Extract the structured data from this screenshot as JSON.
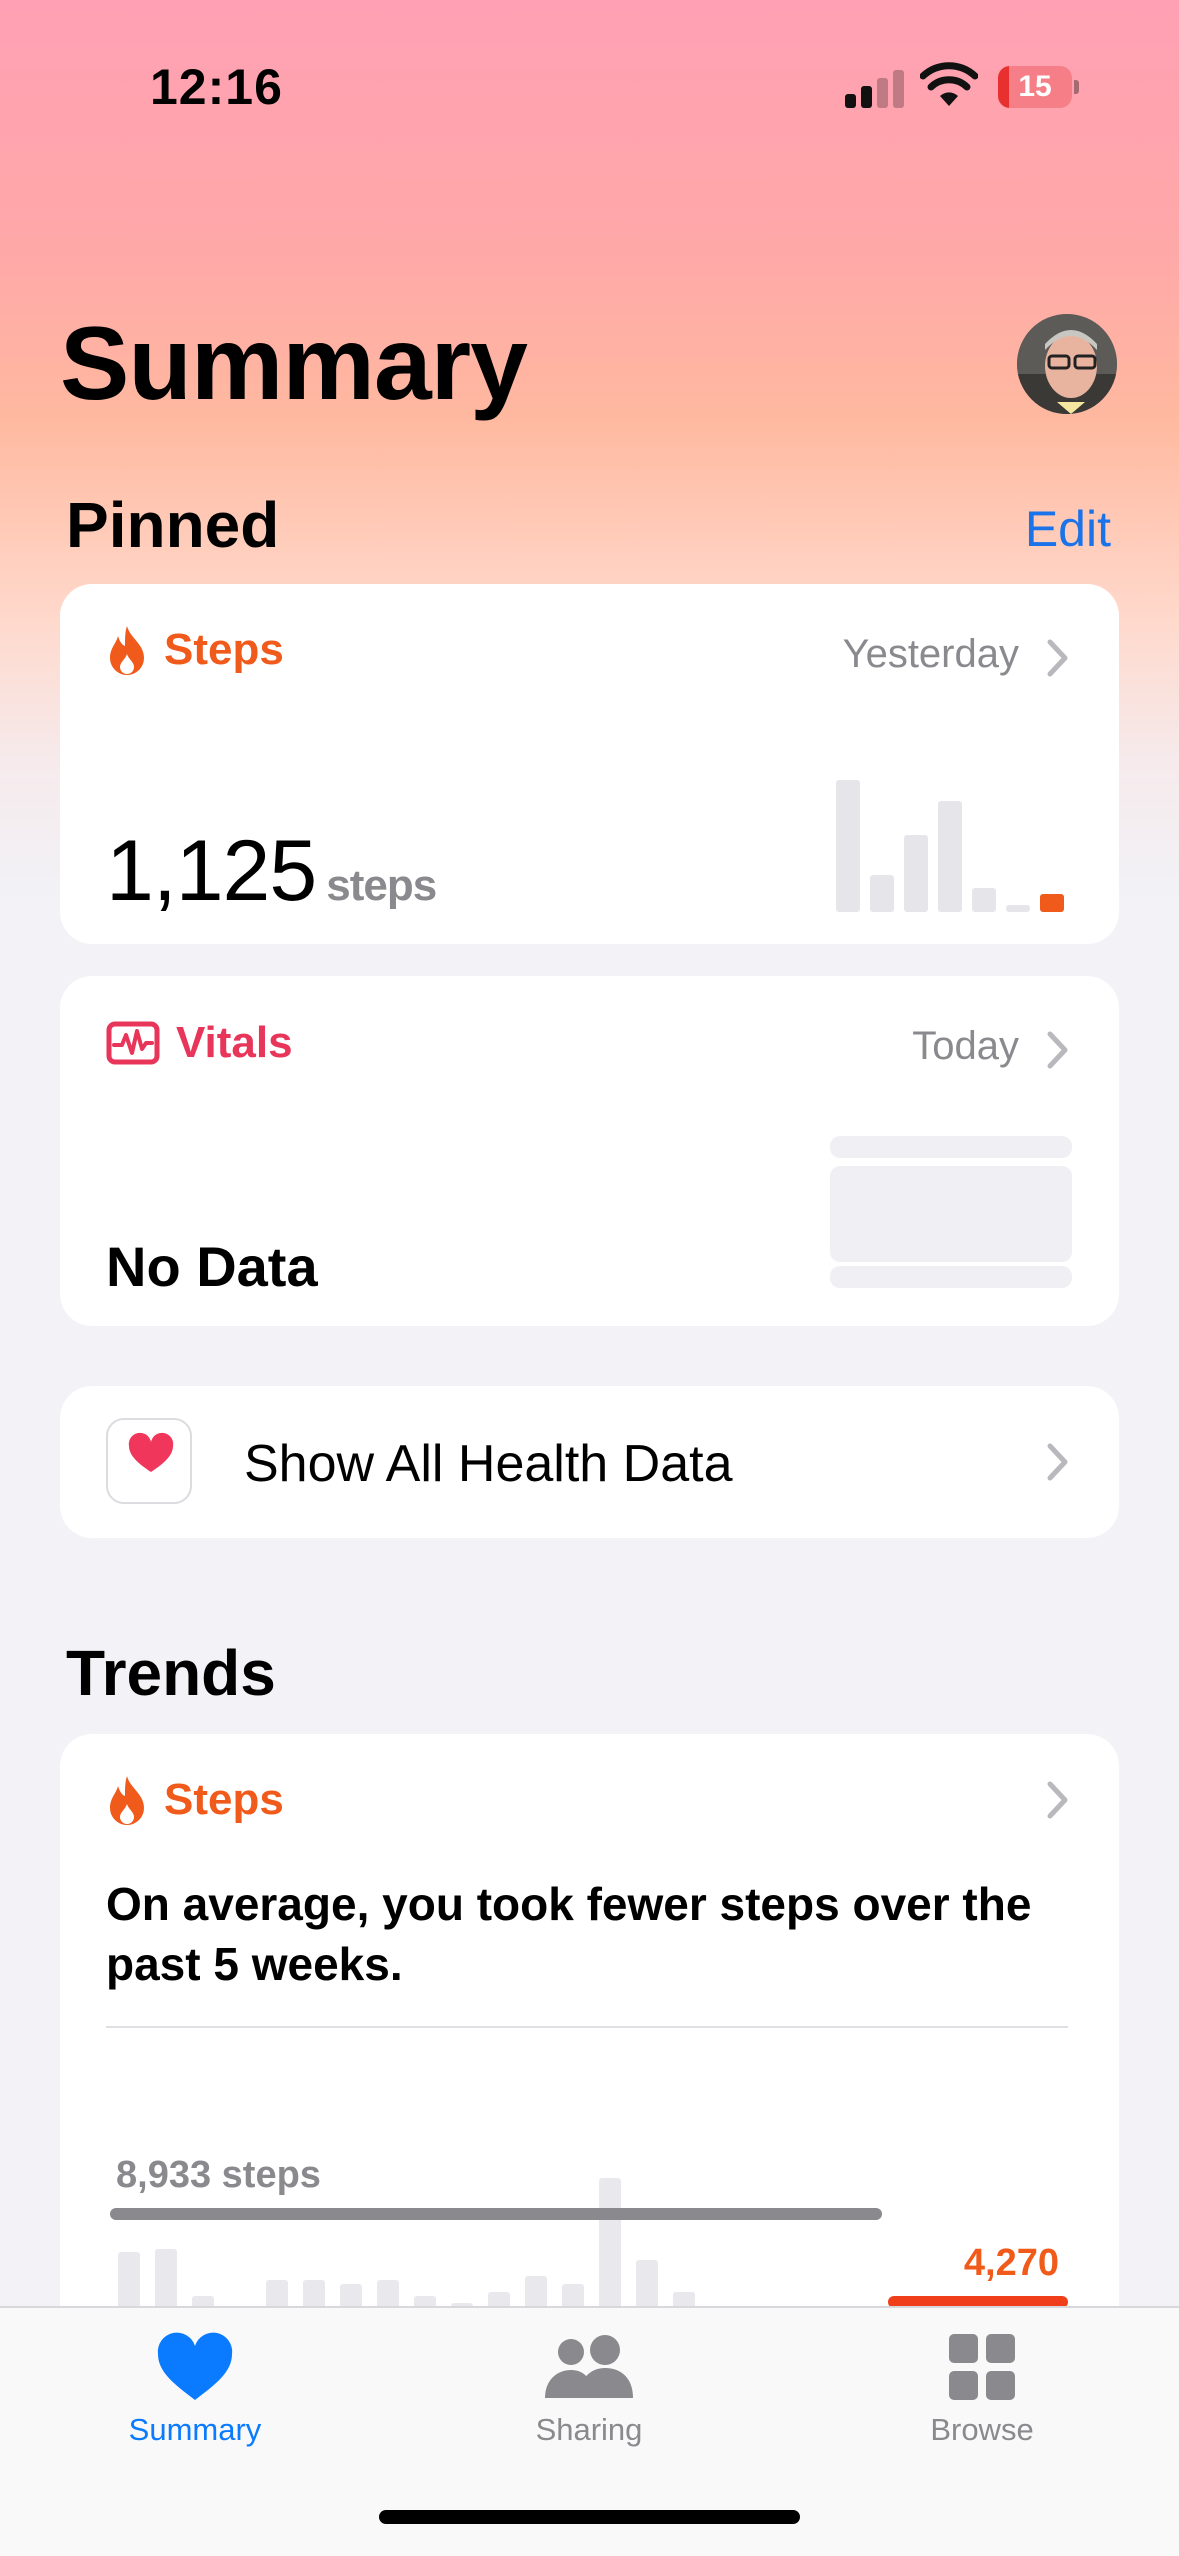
{
  "status_bar": {
    "time": "12:16",
    "battery_level": "15",
    "battery_fraction": 0.15
  },
  "header": {
    "title": "Summary",
    "profile_icon": "avatar-photo"
  },
  "pinned": {
    "section_title": "Pinned",
    "edit_label": "Edit",
    "steps_card": {
      "label": "Steps",
      "date": "Yesterday",
      "value": "1,125",
      "unit": "steps",
      "icon": "flame-icon",
      "accent": "#f05a1a",
      "mini_chart": [
        100,
        28,
        58,
        84,
        18,
        5,
        14
      ]
    },
    "vitals_card": {
      "label": "Vitals",
      "date": "Today",
      "value": "No Data",
      "icon": "waveform-icon",
      "accent": "#e8365a"
    },
    "all_data_row": {
      "label": "Show All Health Data",
      "icon": "heart-icon",
      "accent": "#f0365a"
    }
  },
  "trends": {
    "section_title": "Trends",
    "card": {
      "label": "Steps",
      "icon": "flame-icon",
      "text": "On average, you took fewer steps over the past 5 weeks.",
      "average_label": "8,933 steps",
      "recent_label": "4,270"
    }
  },
  "tab_bar": {
    "tabs": [
      {
        "label": "Summary",
        "icon": "heart-icon",
        "active": true
      },
      {
        "label": "Sharing",
        "icon": "people-icon",
        "active": false
      },
      {
        "label": "Browse",
        "icon": "grid-icon",
        "active": false
      }
    ],
    "active_color": "#0a7aff",
    "inactive_color": "#8a8a8e"
  }
}
